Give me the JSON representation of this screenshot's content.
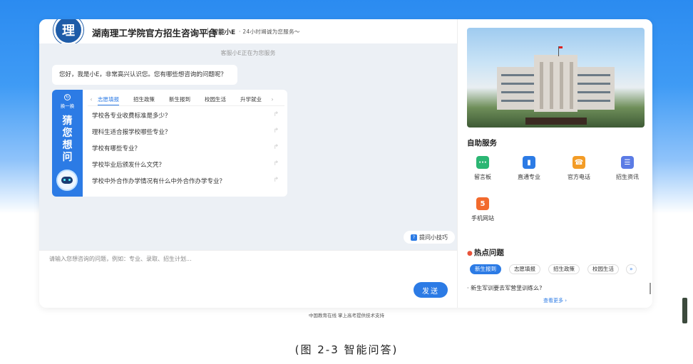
{
  "header": {
    "logo_text": "理",
    "title": "湖南理工学院官方招生咨询平台",
    "bot_name": "智能小E",
    "tagline": "· 24小时竭诚为您服务～"
  },
  "chat": {
    "status": "客服小E正在为您服务",
    "greeting": "您好，我是小E，非常高兴认识您。您有哪些想咨询的问题呢？",
    "side": {
      "swap_label": "换一换",
      "guess": [
        "猜",
        "您",
        "想",
        "问"
      ]
    },
    "tabs": [
      "志愿填报",
      "招生政策",
      "新生报到",
      "校园生活",
      "升学就业"
    ],
    "active_tab": "志愿填报",
    "questions": [
      "学校各专业收费标准是多少？",
      "理科生适合报学校哪些专业？",
      "学校有哪些专业？",
      "学校毕业后颁发什么文凭？",
      "学校中外合作办学情况有什么中外合作办学专业？"
    ],
    "tips_label": "提问小技巧",
    "input_placeholder": "请输入您想咨询的问题，例如：专业、录取、招生计划...",
    "send_label": "发送"
  },
  "right": {
    "self_service_title": "自助服务",
    "services": [
      {
        "label": "留言板",
        "icon": "message-board-icon",
        "color": "#2bb673",
        "glyph": "···"
      },
      {
        "label": "直通专业",
        "icon": "major-icon",
        "color": "#2c7be5",
        "glyph": "▮"
      },
      {
        "label": "官方电话",
        "icon": "phone-icon",
        "color": "#f39c26",
        "glyph": "☎"
      },
      {
        "label": "招生资讯",
        "icon": "news-icon",
        "color": "#5b7be5",
        "glyph": "☰"
      },
      {
        "label": "手机网站",
        "icon": "html5-icon",
        "color": "#f26a2d",
        "glyph": "5"
      }
    ],
    "hot_title": "热点问题",
    "hot_tabs": [
      "新生报到",
      "志愿填报",
      "招生政策",
      "校园生活"
    ],
    "hot_active": "新生报到",
    "hot_question": "· 新生军训要去军营里训练么?",
    "more_label": "查看更多 ›"
  },
  "footer": "中国教育在线 掌上高考提供技术支持",
  "caption": "(图 2-3 智能问答)"
}
